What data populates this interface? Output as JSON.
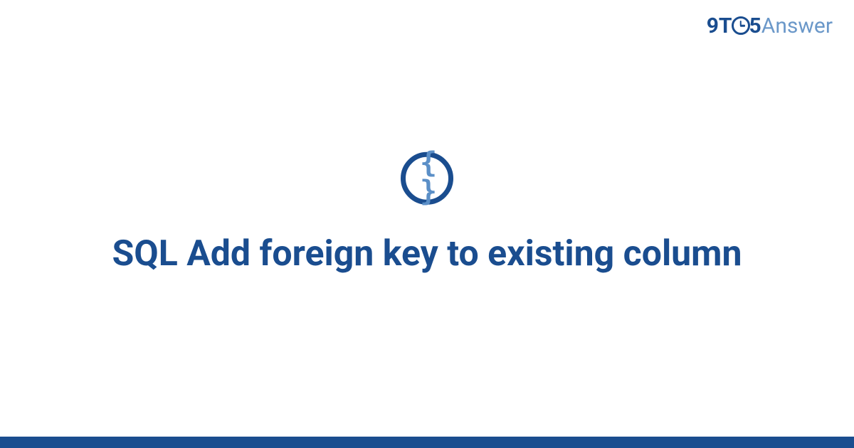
{
  "brand": {
    "part1": "9T",
    "part2": "5",
    "part3": "Answer"
  },
  "icon": {
    "glyph": "{ }"
  },
  "title": "SQL Add foreign key to existing column"
}
